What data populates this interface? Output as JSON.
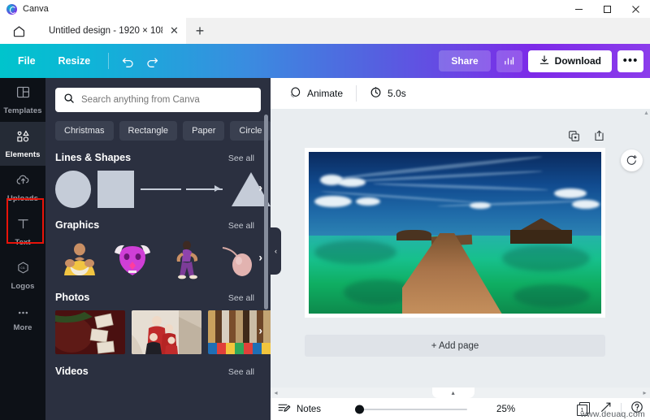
{
  "window": {
    "app_name": "Canva",
    "logo_icon": "canva-logo-icon",
    "minimize_label": "–",
    "maximize_label": "□",
    "close_label": "✕"
  },
  "tabstrip": {
    "home_icon": "home-icon",
    "tab_title": "Untitled design - 1920 × 108(",
    "tab_close_label": "✕",
    "new_tab_label": "+"
  },
  "toolbar": {
    "file_label": "File",
    "resize_label": "Resize",
    "undo_icon": "undo-icon",
    "redo_icon": "redo-icon",
    "share_label": "Share",
    "stats_icon": "bar-chart-icon",
    "download_label": "Download",
    "download_icon": "download-icon",
    "more_label": "•••",
    "gradient_start": "#00C4CC",
    "gradient_end": "#7D2AE8"
  },
  "rail": {
    "items": [
      {
        "label": "Templates",
        "icon": "templates-icon",
        "active": false
      },
      {
        "label": "Elements",
        "icon": "elements-icon",
        "active": true
      },
      {
        "label": "Uploads",
        "icon": "uploads-icon",
        "active": false
      },
      {
        "label": "Text",
        "icon": "text-icon",
        "active": false
      },
      {
        "label": "Logos",
        "icon": "logos-icon",
        "active": false
      },
      {
        "label": "More",
        "icon": "more-dots-icon",
        "active": false
      }
    ],
    "highlight_color": "#E81309",
    "highlight_target": "Elements"
  },
  "panel": {
    "search": {
      "placeholder": "Search anything from Canva",
      "value": "",
      "icon": "search-icon"
    },
    "chips": [
      "Christmas",
      "Rectangle",
      "Paper",
      "Circle"
    ],
    "chips_next_icon": "chevron-right-icon",
    "sections": [
      {
        "title": "Lines & Shapes",
        "see_all": "See all",
        "items": [
          "circle-shape",
          "square-shape",
          "line-shape",
          "arrow-shape",
          "triangle-shape"
        ]
      },
      {
        "title": "Graphics",
        "see_all": "See all",
        "items": [
          "person-graphic",
          "bull-skull-graphic",
          "dancer-graphic",
          "balloon-graphic"
        ]
      },
      {
        "title": "Photos",
        "see_all": "See all",
        "items": [
          "gift-photo",
          "family-photo",
          "fabric-photo"
        ]
      },
      {
        "title": "Videos",
        "see_all": "See all",
        "items": []
      }
    ],
    "collapse_icon": "chevron-left-icon"
  },
  "editor": {
    "animate_label": "Animate",
    "animate_icon": "animate-icon",
    "duration_label": "5.0s",
    "duration_icon": "clock-icon",
    "duplicate_page_icon": "duplicate-page-icon",
    "add_page_icon": "add-page-icon",
    "comment_icon": "comment-add-icon",
    "add_page_label": "+ Add page",
    "canvas_image": "tropical-pier-overwater-bungalow-photo"
  },
  "statusbar": {
    "notes_label": "Notes",
    "notes_icon": "notes-icon",
    "zoom_value": "25%",
    "zoom_slider_position": 0,
    "page_number": "1",
    "page_badge_icon": "page-count-icon",
    "expand_icon": "expand-icon",
    "help_icon": "help-icon",
    "watermark": "www.deuaq.com",
    "scroll_left_icon": "◂",
    "scroll_right_icon": "▸",
    "timeline_toggle_icon": "▴"
  }
}
